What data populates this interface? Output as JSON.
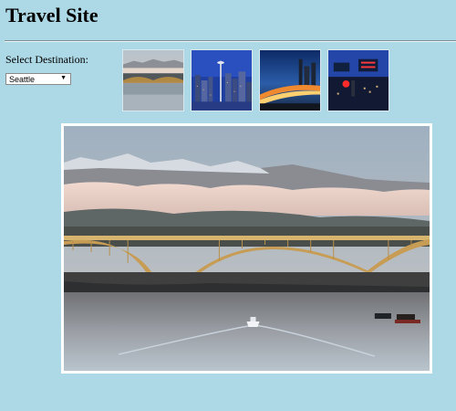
{
  "page": {
    "title": "Travel Site"
  },
  "destination": {
    "label": "Select Destination:",
    "selected": "Seattle"
  },
  "thumbnails": [
    {
      "name": "seattle-bridge"
    },
    {
      "name": "seattle-skyline-night"
    },
    {
      "name": "seattle-freeway-dusk"
    },
    {
      "name": "pike-place-market-sign"
    }
  ],
  "colors": {
    "background": "#add8e6"
  }
}
